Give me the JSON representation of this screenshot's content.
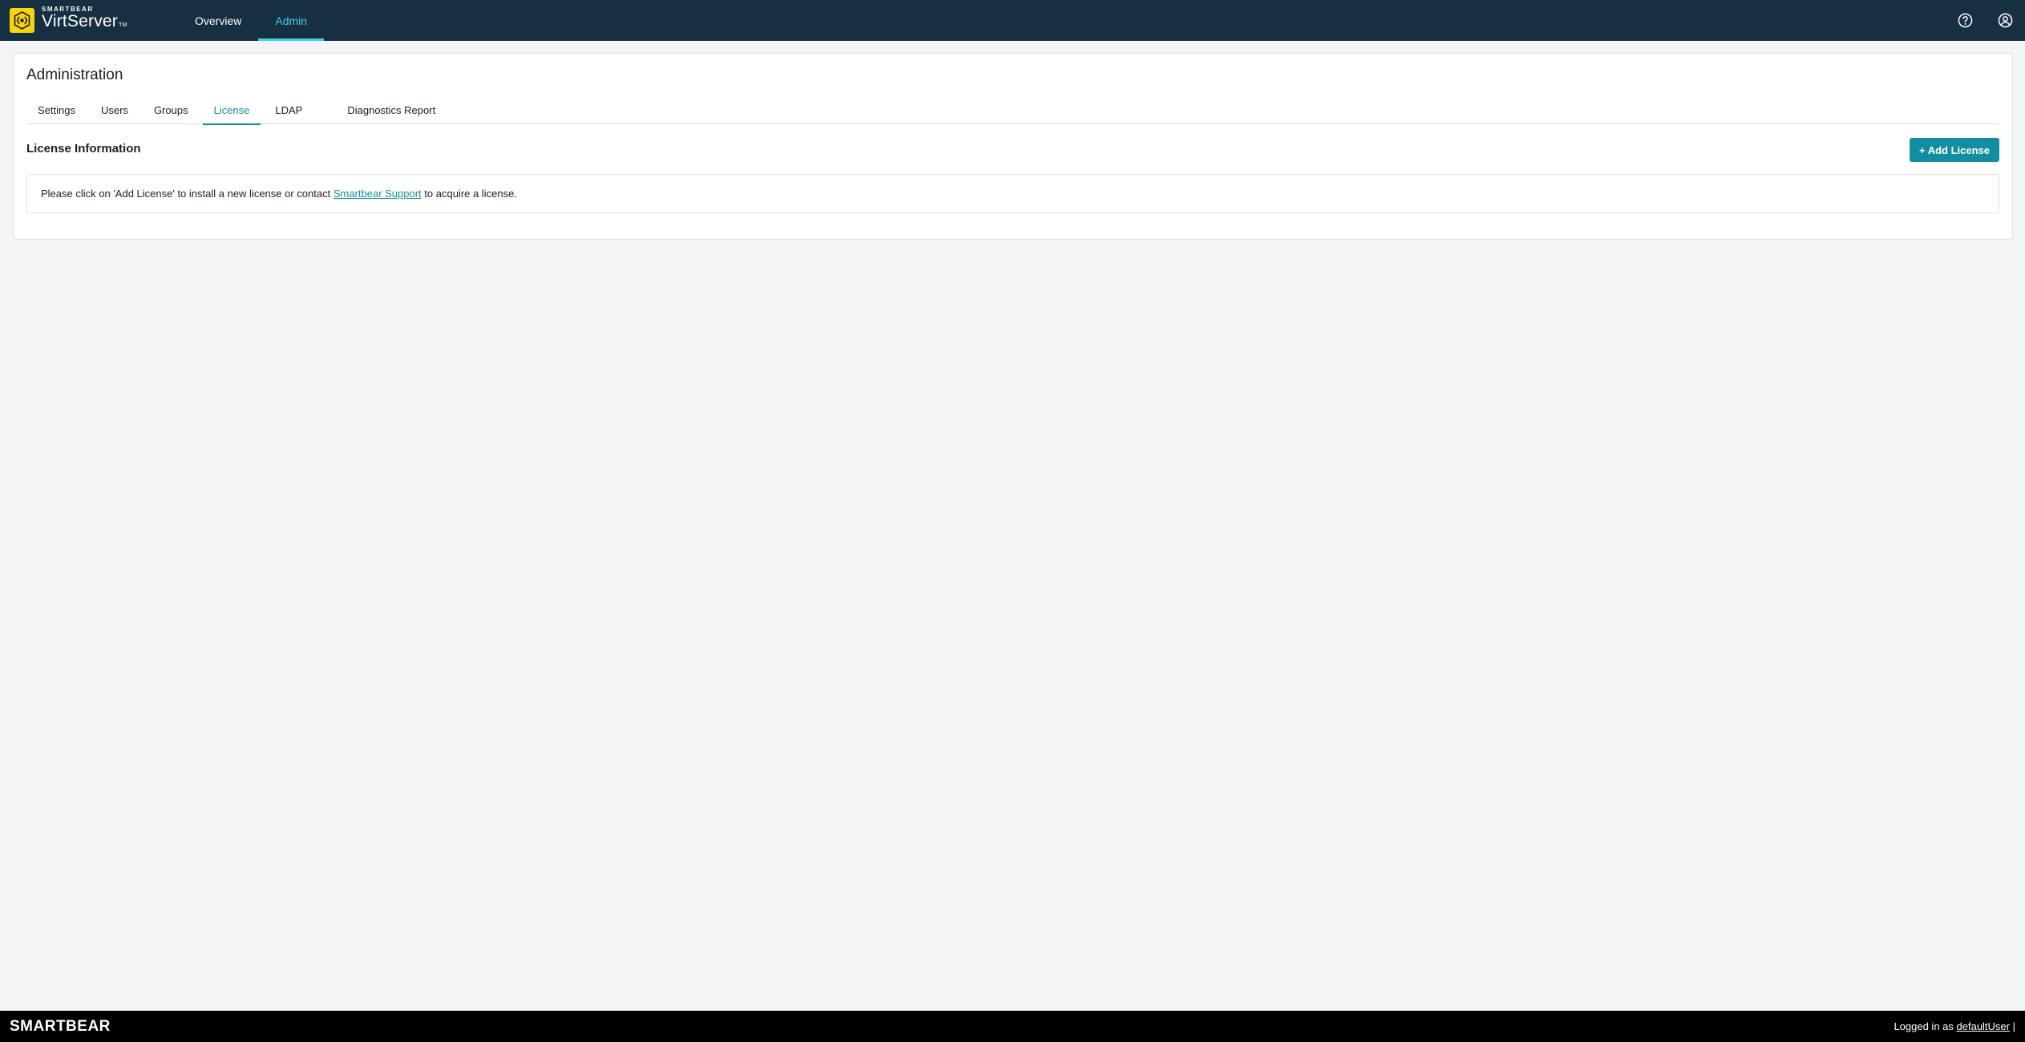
{
  "header": {
    "brand_top": "SMARTBEAR",
    "brand_name": "VirtServer",
    "brand_tm": "TM",
    "nav": [
      {
        "label": "Overview"
      },
      {
        "label": "Admin"
      }
    ],
    "icons": [
      "help-icon",
      "user-account-icon"
    ]
  },
  "admin": {
    "title": "Administration",
    "tabs": [
      {
        "label": "Settings"
      },
      {
        "label": "Users"
      },
      {
        "label": "Groups"
      },
      {
        "label": "License"
      },
      {
        "label": "LDAP"
      },
      {
        "label": "Diagnostics Report"
      }
    ],
    "active_tab": "License"
  },
  "license": {
    "section_title": "License Information",
    "add_button": "+ Add License",
    "message_before": "Please click on 'Add License' to install a new license or contact ",
    "support_link": "Smartbear Support",
    "message_after": " to acquire a license."
  },
  "footer": {
    "logo": "SMARTBEAR",
    "logged_in_prefix": "Logged in as ",
    "username": "defaultUser",
    "separator": " |"
  },
  "colors": {
    "topbar": "#163042",
    "accent": "#3ed3e6",
    "button": "#128ea0",
    "brand_yellow": "#f5d50b",
    "footer": "#000000"
  }
}
